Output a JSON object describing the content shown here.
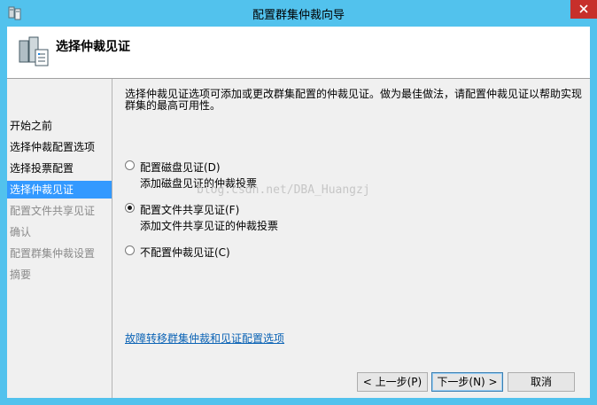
{
  "window": {
    "title": "配置群集仲裁向导"
  },
  "header": {
    "title": "选择仲裁见证"
  },
  "sidebar": {
    "items": [
      {
        "label": "开始之前",
        "state": "normal"
      },
      {
        "label": "选择仲裁配置选项",
        "state": "normal"
      },
      {
        "label": "选择投票配置",
        "state": "normal"
      },
      {
        "label": "选择仲裁见证",
        "state": "active"
      },
      {
        "label": "配置文件共享见证",
        "state": "disabled"
      },
      {
        "label": "确认",
        "state": "disabled"
      },
      {
        "label": "配置群集仲裁设置",
        "state": "disabled"
      },
      {
        "label": "摘要",
        "state": "disabled"
      }
    ]
  },
  "main": {
    "description": "选择仲裁见证选项可添加或更改群集配置的仲裁见证。做为最佳做法，请配置仲裁见证以帮助实现群集的最高可用性。",
    "options": [
      {
        "label": "配置磁盘见证(D)",
        "sub": "添加磁盘见证的仲裁投票",
        "selected": false
      },
      {
        "label": "配置文件共享见证(F)",
        "sub": "添加文件共享见证的仲裁投票",
        "selected": true
      },
      {
        "label": "不配置仲裁见证(C)",
        "sub": "",
        "selected": false
      }
    ],
    "help_link": "故障转移群集仲裁和见证配置选项",
    "watermark": "blog.csdn.net/DBA_Huangzj"
  },
  "buttons": {
    "back": "< 上一步(P)",
    "next": "下一步(N) >",
    "cancel": "取消"
  },
  "colors": {
    "titlebar": "#52c2ed",
    "active_item": "#3399ff",
    "close": "#c7302b",
    "link": "#0b63b5"
  }
}
